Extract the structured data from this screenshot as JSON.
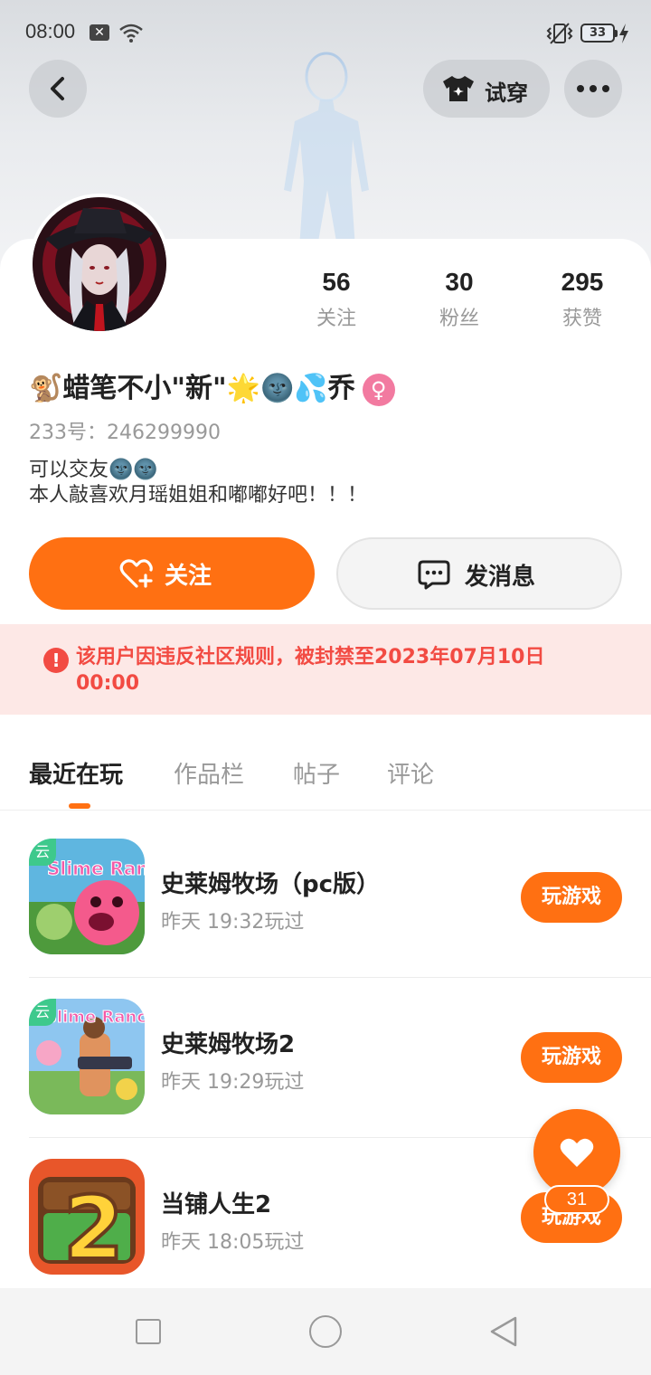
{
  "status_bar": {
    "time": "08:00",
    "battery": "33"
  },
  "header": {
    "tryon_label": "试穿"
  },
  "profile": {
    "username": "🐒蜡笔不小\"新\"🌟🌚💦乔",
    "gender_symbol": "♀",
    "uid": "233号：246299990",
    "bio": "可以交友🌚🌚\n本人敲喜欢月瑶姐姐和嘟嘟好吧！！！",
    "stats": [
      {
        "value": "56",
        "label": "关注"
      },
      {
        "value": "30",
        "label": "粉丝"
      },
      {
        "value": "295",
        "label": "获赞"
      }
    ]
  },
  "actions": {
    "follow_label": "关注",
    "message_label": "发消息"
  },
  "ban_notice": {
    "icon": "!",
    "text": "该用户因违反社区规则，被封禁至2023年07月10日 00:00"
  },
  "tabs": [
    {
      "label": "最近在玩",
      "active": true
    },
    {
      "label": "作品栏",
      "active": false
    },
    {
      "label": "帖子",
      "active": false
    },
    {
      "label": "评论",
      "active": false
    }
  ],
  "games": [
    {
      "name": "史莱姆牧场（pc版）",
      "time": "昨天 19:32玩过",
      "button": "玩游戏",
      "cloud_badge": "云"
    },
    {
      "name": "史莱姆牧场2",
      "time": "昨天 19:29玩过",
      "button": "玩游戏",
      "cloud_badge": "云"
    },
    {
      "name": "当铺人生2",
      "time": "昨天 18:05玩过",
      "button": "玩游戏"
    }
  ],
  "like_fab": {
    "count": "31"
  },
  "colors": {
    "accent": "#ff7012",
    "ban_text": "#f24b43",
    "ban_bg": "#fde8e6"
  }
}
